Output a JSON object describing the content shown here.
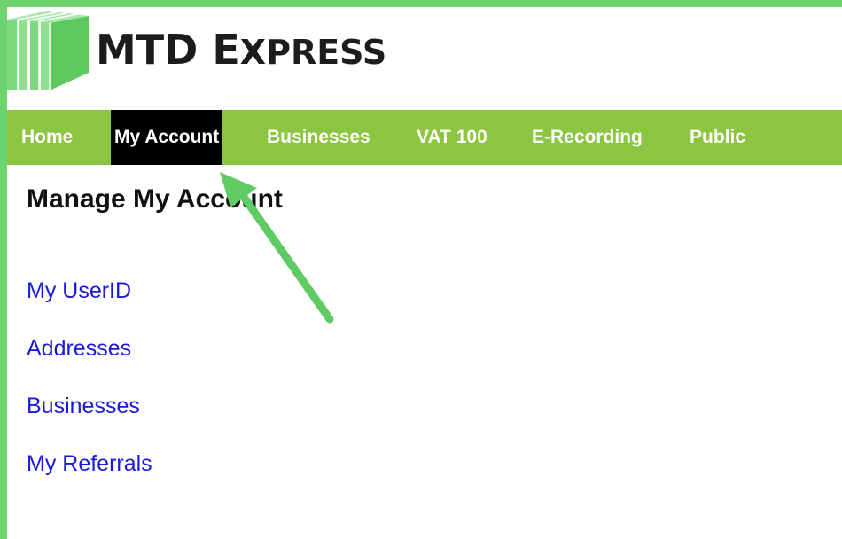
{
  "brand": {
    "name_first": "MTD",
    "name_second_initial": "E",
    "name_second_rest": "XPRESS",
    "logo_icon": "stacked-boxes-logo",
    "accent_color": "#6cd36f",
    "nav_color": "#8cc53f"
  },
  "nav": {
    "items": [
      {
        "label": "Home",
        "active": false
      },
      {
        "label": "My Account",
        "active": true
      },
      {
        "label": "Businesses",
        "active": false
      },
      {
        "label": "VAT 100",
        "active": false
      },
      {
        "label": "E-Recording",
        "active": false
      },
      {
        "label": "Public",
        "active": false
      }
    ]
  },
  "main": {
    "title": "Manage My Account",
    "links": [
      {
        "label": "My UserID"
      },
      {
        "label": "Addresses"
      },
      {
        "label": "Businesses"
      },
      {
        "label": "My Referrals"
      }
    ]
  },
  "annotation": {
    "icon": "pointer-arrow-icon",
    "color": "#5ecb63"
  }
}
